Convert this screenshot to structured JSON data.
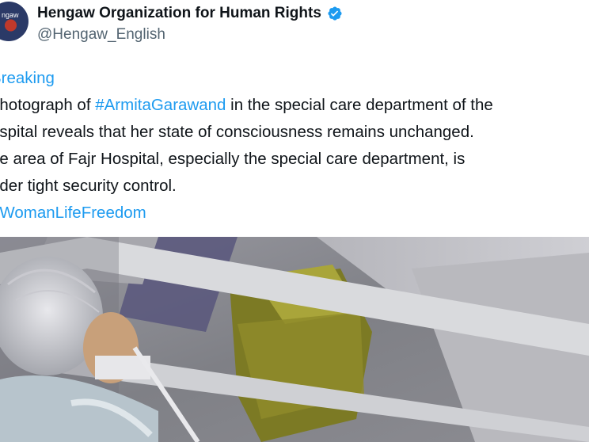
{
  "author": {
    "name": "Hengaw Organization for Human Rights",
    "handle": "@Hengaw_English",
    "avatar_text": "ngaw",
    "verified": true,
    "verified_color": "#1d9bf0"
  },
  "tweet": {
    "heading": "Breaking",
    "line1_pre": "photograph of ",
    "line1_hashtag": "#ArmitaGarawand",
    "line1_post": " in the special care department of the",
    "line2": "ospital reveals that her state of consciousness remains unchanged.",
    "line3": "he area of Fajr Hospital, especially the special care department, is",
    "line4": "nder tight security control.",
    "hashtag2": "#WomanLifeFreedom"
  },
  "colors": {
    "link": "#1d9bf0",
    "text": "#0f1419",
    "secondary": "#536471"
  },
  "media": {
    "icon": "photo-media"
  }
}
